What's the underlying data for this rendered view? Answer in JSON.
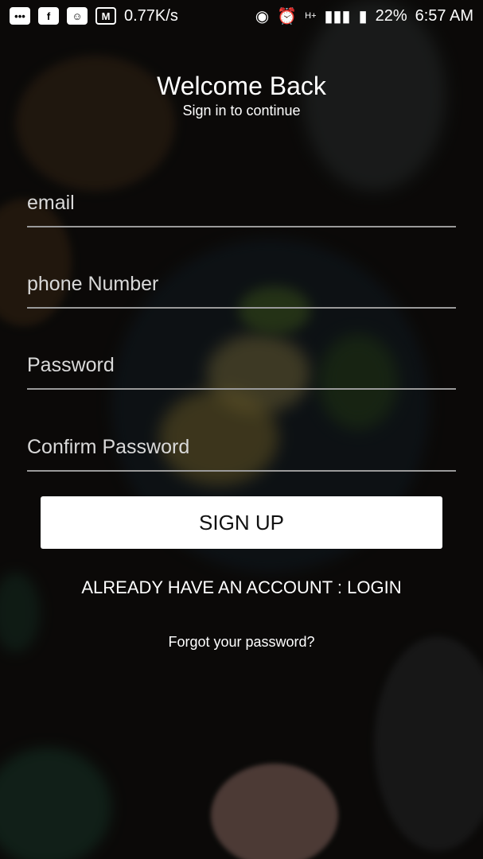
{
  "status_bar": {
    "left_icons": [
      "more-icon",
      "facebook-icon",
      "messenger-icon",
      "gmail-icon"
    ],
    "speed": "0.77K/s",
    "network_type": "H+",
    "battery_percent": "22%",
    "time": "6:57 AM"
  },
  "header": {
    "title": "Welcome Back",
    "subtitle": "Sign in to continue"
  },
  "form": {
    "email_placeholder": "email",
    "phone_placeholder": "phone Number",
    "password_placeholder": "Password",
    "confirm_password_placeholder": "Confirm Password",
    "signup_label": "SIGN UP"
  },
  "links": {
    "login": "ALREADY HAVE AN ACCOUNT : LOGIN",
    "forgot": "Forgot your password?"
  }
}
